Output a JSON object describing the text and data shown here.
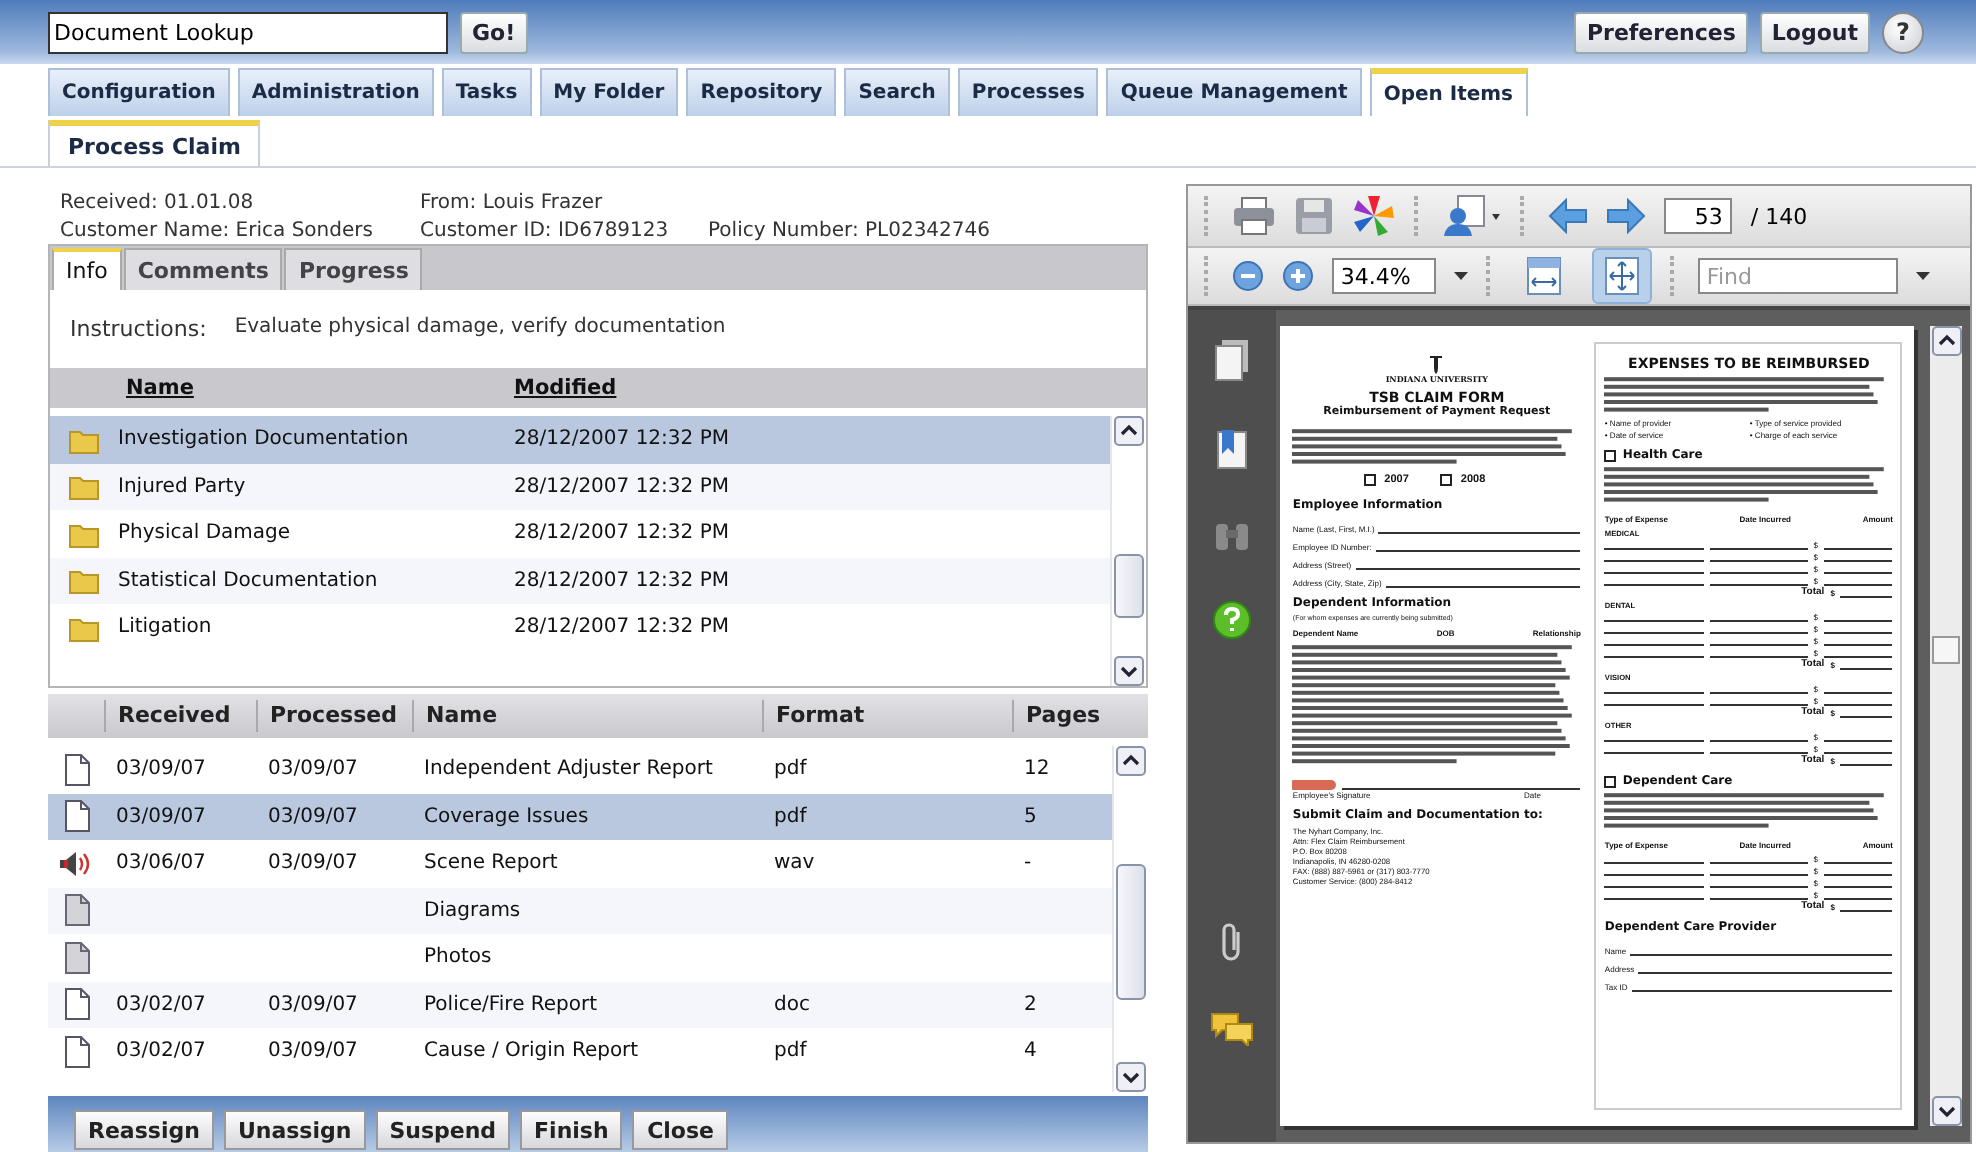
{
  "top_bar": {
    "lookup": {
      "value": "Document Lookup"
    },
    "go_button": "Go!",
    "buttons": [
      "Preferences",
      "Logout"
    ],
    "help": "?"
  },
  "nav_tabs": [
    {
      "label": "Configuration",
      "selected": false
    },
    {
      "label": "Administration",
      "selected": false
    },
    {
      "label": "Tasks",
      "selected": false
    },
    {
      "label": "My Folder",
      "selected": false
    },
    {
      "label": "Repository",
      "selected": false
    },
    {
      "label": "Search",
      "selected": false
    },
    {
      "label": "Processes",
      "selected": false
    },
    {
      "label": "Queue Management",
      "selected": false
    },
    {
      "label": "Open Items",
      "selected": true
    }
  ],
  "sub_tabs": [
    {
      "label": "Process Claim",
      "selected": true
    }
  ],
  "claim": {
    "rows": [
      [
        "Received: 01.01.08",
        "From: Louis Frazer"
      ],
      [
        "Customer Name: Erica Sonders",
        "Customer ID: ID6789123",
        "Policy Number: PL02342746"
      ]
    ]
  },
  "detail_tabs": [
    {
      "label": "Info",
      "selected": true
    },
    {
      "label": "Comments",
      "selected": false
    },
    {
      "label": "Progress",
      "selected": false
    }
  ],
  "instructions": {
    "label": "Instructions:",
    "text": "Evaluate physical damage, verify documentation"
  },
  "folders": {
    "columns": [
      "Name",
      "Modified"
    ],
    "rows": [
      {
        "name": "Investigation Documentation",
        "modified": "28/12/2007 12:32 PM",
        "selected": true
      },
      {
        "name": "Injured Party",
        "modified": "28/12/2007 12:32 PM",
        "selected": false
      },
      {
        "name": "Physical Damage",
        "modified": "28/12/2007 12:32 PM",
        "selected": false
      },
      {
        "name": "Statistical Documentation",
        "modified": "28/12/2007 12:32 PM",
        "selected": false
      },
      {
        "name": "Litigation",
        "modified": "28/12/2007 12:32 PM",
        "selected": false
      }
    ]
  },
  "documents": {
    "columns": [
      "Received",
      "Processed",
      "Name",
      "Format",
      "Pages"
    ],
    "rows": [
      {
        "kind": "document",
        "received": "03/09/07",
        "processed": "03/09/07",
        "name": "Independent Adjuster Report",
        "format": "pdf",
        "pages": "12",
        "selected": false
      },
      {
        "kind": "document",
        "received": "03/09/07",
        "processed": "03/09/07",
        "name": "Coverage Issues",
        "format": "pdf",
        "pages": "5",
        "selected": true
      },
      {
        "kind": "audio",
        "received": "03/06/07",
        "processed": "03/09/07",
        "name": "Scene Report",
        "format": "wav",
        "pages": "-",
        "selected": false
      },
      {
        "kind": "placeholder",
        "name": "Diagrams",
        "selected": false
      },
      {
        "kind": "placeholder",
        "name": "Photos",
        "selected": false
      },
      {
        "kind": "document",
        "received": "03/02/07",
        "processed": "03/09/07",
        "name": "Police/Fire Report",
        "format": "doc",
        "pages": "2",
        "selected": false
      },
      {
        "kind": "document",
        "received": "03/02/07",
        "processed": "03/09/07",
        "name": "Cause / Origin Report",
        "format": "pdf",
        "pages": "4",
        "selected": false
      }
    ]
  },
  "actions": [
    "Reassign",
    "Unassign",
    "Suspend",
    "Finish",
    "Close"
  ],
  "viewer": {
    "page_number": "53",
    "page_count": "/ 140",
    "zoom": "34.4%",
    "find_placeholder": "Find",
    "view_tools": [
      {
        "kind": "fit-width",
        "selected": false
      },
      {
        "kind": "fit-page",
        "selected": true
      }
    ],
    "document_page": {
      "left": [
        {
          "kind": "emblem"
        },
        {
          "kind": "org",
          "text": "INDIANA UNIVERSITY"
        },
        {
          "kind": "title",
          "text": "TSB CLAIM FORM"
        },
        {
          "kind": "subtitle",
          "text": "Reimbursement of Payment Request"
        },
        {
          "kind": "para"
        },
        {
          "kind": "checks",
          "options": [
            "2007",
            "2008"
          ]
        },
        {
          "kind": "heading",
          "text": "Employee Information"
        },
        {
          "kind": "fields",
          "labels": [
            "Name (Last, First, M.I.)",
            "Employee ID Number:",
            "Address (Street)",
            "Address (City, State, Zip)"
          ]
        },
        {
          "kind": "heading",
          "text": "Dependent Information"
        },
        {
          "kind": "note",
          "text": "(For whom expenses are currently being submitted)"
        },
        {
          "kind": "columns",
          "labels": [
            "Dependent Name",
            "DOB",
            "Relationship"
          ]
        },
        {
          "kind": "long-para"
        },
        {
          "kind": "signature",
          "labels": [
            "Employee's Signature",
            "Date"
          ]
        },
        {
          "kind": "heading",
          "text": "Submit Claim and Documentation to:"
        },
        {
          "kind": "address",
          "lines": [
            "The Nyhart Company, Inc.",
            "Attn: Flex Claim Reimbursement",
            "P.O. Box 80208",
            "Indianapolis, IN 46280-0208",
            "FAX: (888) 887-5961 or (317) 803-7770",
            "Customer Service: (800) 284-8412"
          ]
        }
      ],
      "right": [
        {
          "kind": "title",
          "text": "EXPENSES TO BE REIMBURSED"
        },
        {
          "kind": "para"
        },
        {
          "kind": "bullets",
          "items": [
            "• Name of provider",
            "• Type of service provided",
            "• Date of service",
            "• Charge of each service"
          ]
        },
        {
          "kind": "check-heading",
          "text": "Health Care"
        },
        {
          "kind": "para"
        },
        {
          "kind": "columns",
          "labels": [
            "Type of Expense",
            "Date Incurred",
            "Amount"
          ]
        },
        {
          "kind": "expenses",
          "label": "MEDICAL",
          "marks": [
            "$",
            "$",
            "$",
            "$"
          ],
          "total": "Total",
          "total_mark": "$"
        },
        {
          "kind": "expenses",
          "label": "DENTAL",
          "marks": [
            "$",
            "$",
            "$",
            "$"
          ],
          "total": "Total",
          "total_mark": "$"
        },
        {
          "kind": "expenses",
          "label": "VISION",
          "marks": [
            "$",
            "$"
          ],
          "total": "Total",
          "total_mark": "$"
        },
        {
          "kind": "expenses",
          "label": "OTHER",
          "marks": [
            "$",
            "$"
          ],
          "total": "Total",
          "total_mark": "$"
        },
        {
          "kind": "check-heading",
          "text": "Dependent Care"
        },
        {
          "kind": "para"
        },
        {
          "kind": "columns",
          "labels": [
            "Type of Expense",
            "Date Incurred",
            "Amount"
          ]
        },
        {
          "kind": "expenses",
          "marks": [
            "$",
            "$",
            "$",
            "$"
          ],
          "total": "Total",
          "total_mark": "$"
        },
        {
          "kind": "heading",
          "text": "Dependent Care Provider"
        },
        {
          "kind": "fields",
          "labels": [
            "Name",
            "Address",
            "Tax ID"
          ]
        }
      ]
    }
  }
}
